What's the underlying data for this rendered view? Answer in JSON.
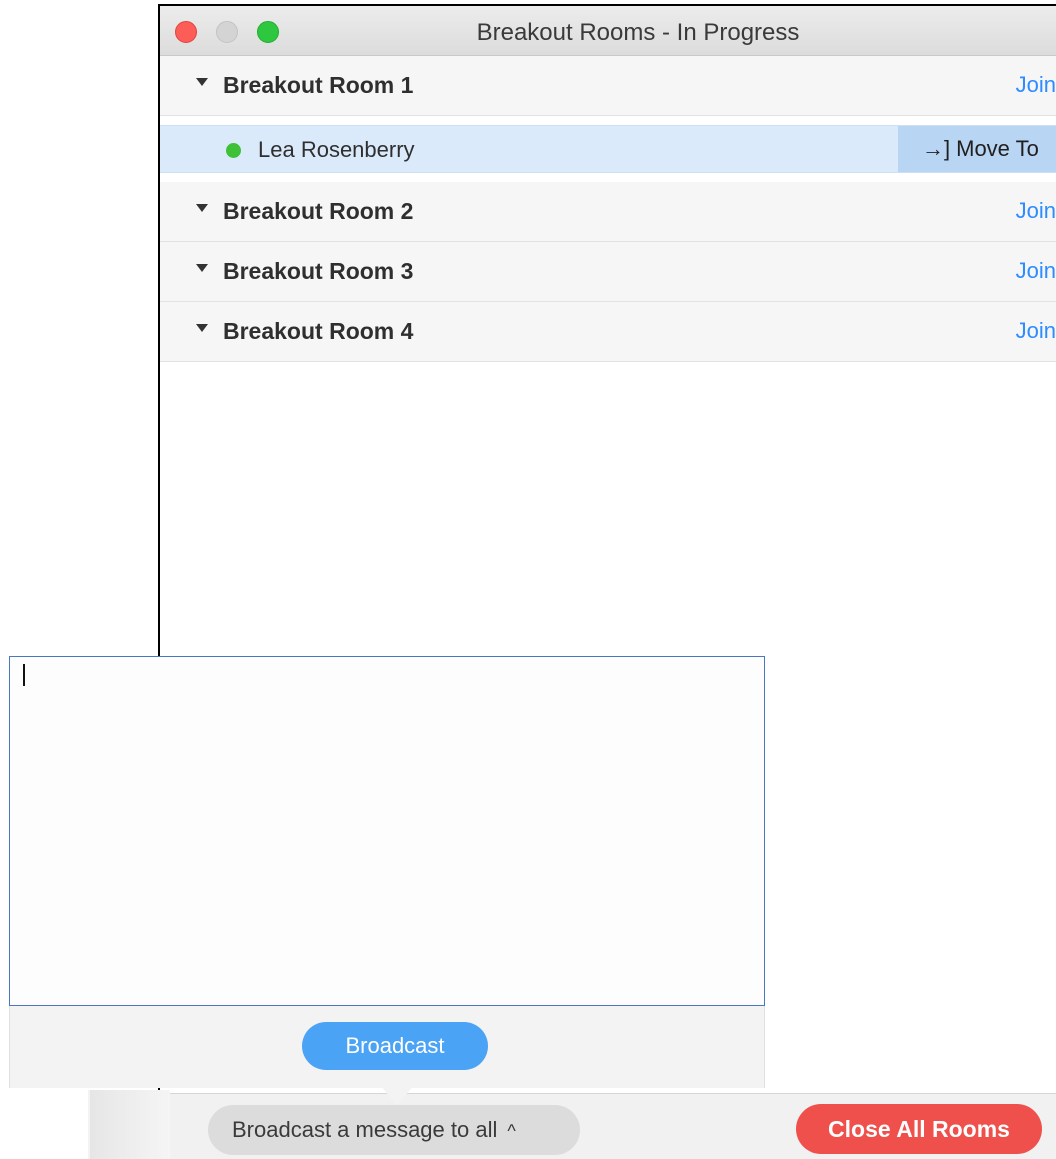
{
  "window": {
    "title": "Breakout Rooms - In Progress"
  },
  "rooms": [
    {
      "name": "Breakout Room 1",
      "join_label": "Join"
    },
    {
      "name": "Breakout Room 2",
      "join_label": "Join"
    },
    {
      "name": "Breakout Room 3",
      "join_label": "Join"
    },
    {
      "name": "Breakout Room 4",
      "join_label": "Join"
    }
  ],
  "participant": {
    "name": "Lea Rosenberry",
    "status_color": "#3fc137",
    "move_to_label": "Move To",
    "move_to_icon": "→]"
  },
  "broadcast_popup": {
    "message_value": "",
    "button_label": "Broadcast"
  },
  "bottom_bar": {
    "broadcast_pill_label": "Broadcast a message to all",
    "broadcast_pill_chevron": "^",
    "close_all_label": "Close All Rooms"
  },
  "colors": {
    "accent_blue": "#2d8cff",
    "broadcast_blue": "#4aa3f5",
    "danger_red": "#f0504b",
    "selected_row": "#dbeafb"
  }
}
